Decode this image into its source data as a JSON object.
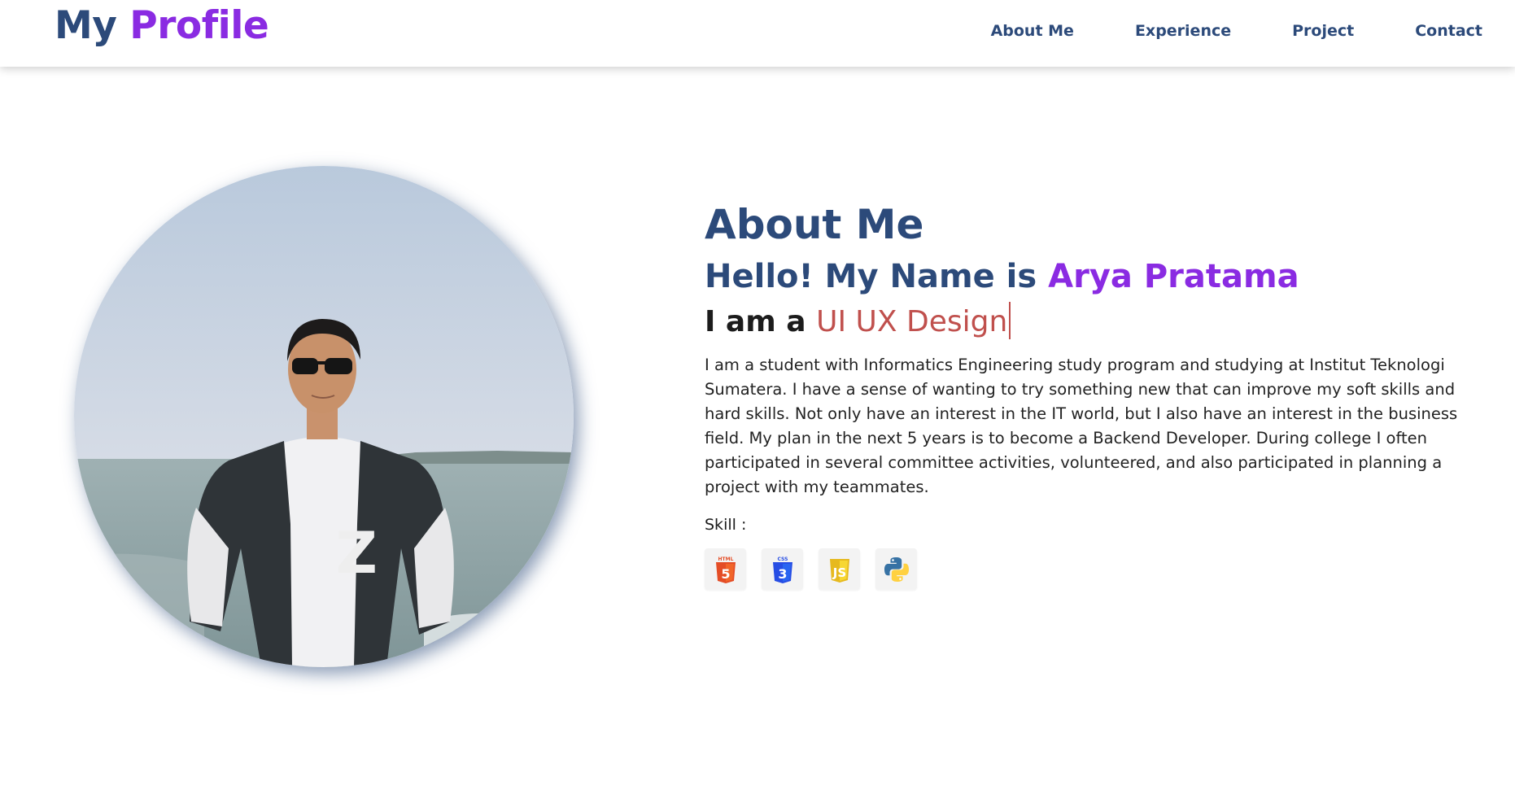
{
  "header": {
    "brand_word1": "My",
    "brand_word2": "Profile",
    "nav": [
      "About Me",
      "Experience",
      "Project",
      "Contact"
    ]
  },
  "about": {
    "title": "About Me",
    "hello_prefix": "Hello! My Name is",
    "name": "Arya Pratama",
    "iam_prefix": "I am a",
    "role": "UI UX Design",
    "description": "I am a student with Informatics Engineering study program and studying at Institut Teknologi Sumatera. I have a sense of wanting to try something new that can improve my soft skills and hard skills. Not only have an interest in the IT world, but I also have an interest in the business field. My plan in the next 5 years is to become a Backend Developer. During college I often participated in several committee activities, volunteered, and also participated in planning a project with my teammates.",
    "skill_label": "Skill :",
    "skills": [
      "html5-icon",
      "css3-icon",
      "javascript-icon",
      "python-icon"
    ]
  },
  "colors": {
    "primary": "#2c4a7a",
    "accent": "#8a2be2",
    "role": "#c0504d"
  }
}
